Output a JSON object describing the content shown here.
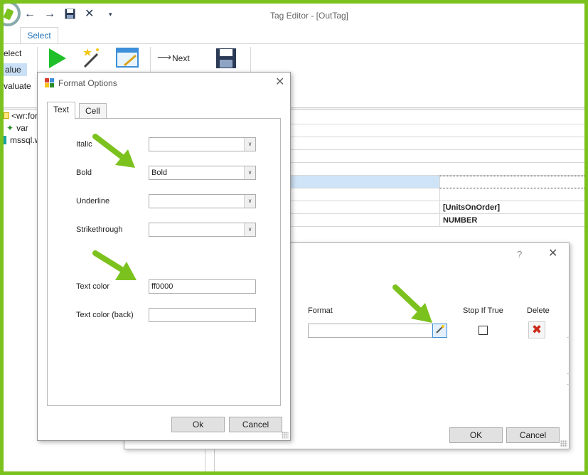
{
  "window": {
    "title": "Tag Editor - [OutTag]",
    "tab_select": "Select"
  },
  "ribbon": {
    "select_label": "elect",
    "value_label": "alue",
    "evaluate_label": "valuate",
    "next_label": "Next"
  },
  "tree": {
    "items": [
      "<wr:for",
      "var",
      "mssql.w"
    ]
  },
  "grid": {
    "field_value": "[UnitsOnOrder]",
    "type_value": "NUMBER"
  },
  "rule_dialog": {
    "help": "?",
    "format_label": "Format",
    "stop_if_true_label": "Stop If True",
    "delete_label": "Delete",
    "format_value": "",
    "ok": "OK",
    "cancel": "Cancel"
  },
  "format_dialog": {
    "title": "Format Options",
    "tabs": [
      "Text",
      "Cell"
    ],
    "fields": {
      "italic": {
        "label": "Italic",
        "value": ""
      },
      "bold": {
        "label": "Bold",
        "value": "Bold"
      },
      "underline": {
        "label": "Underline",
        "value": ""
      },
      "strikethrough": {
        "label": "Strikethrough",
        "value": ""
      },
      "text_color": {
        "label": "Text color",
        "value": "ff0000"
      },
      "text_color_back": {
        "label": "Text color (back)",
        "value": ""
      }
    },
    "ok": "Ok",
    "cancel": "Cancel"
  },
  "colors": {
    "frame": "#7cc21f",
    "arrow": "#7cc21f",
    "selection": "#c9e0f7",
    "accent": "#1e6fb8"
  }
}
